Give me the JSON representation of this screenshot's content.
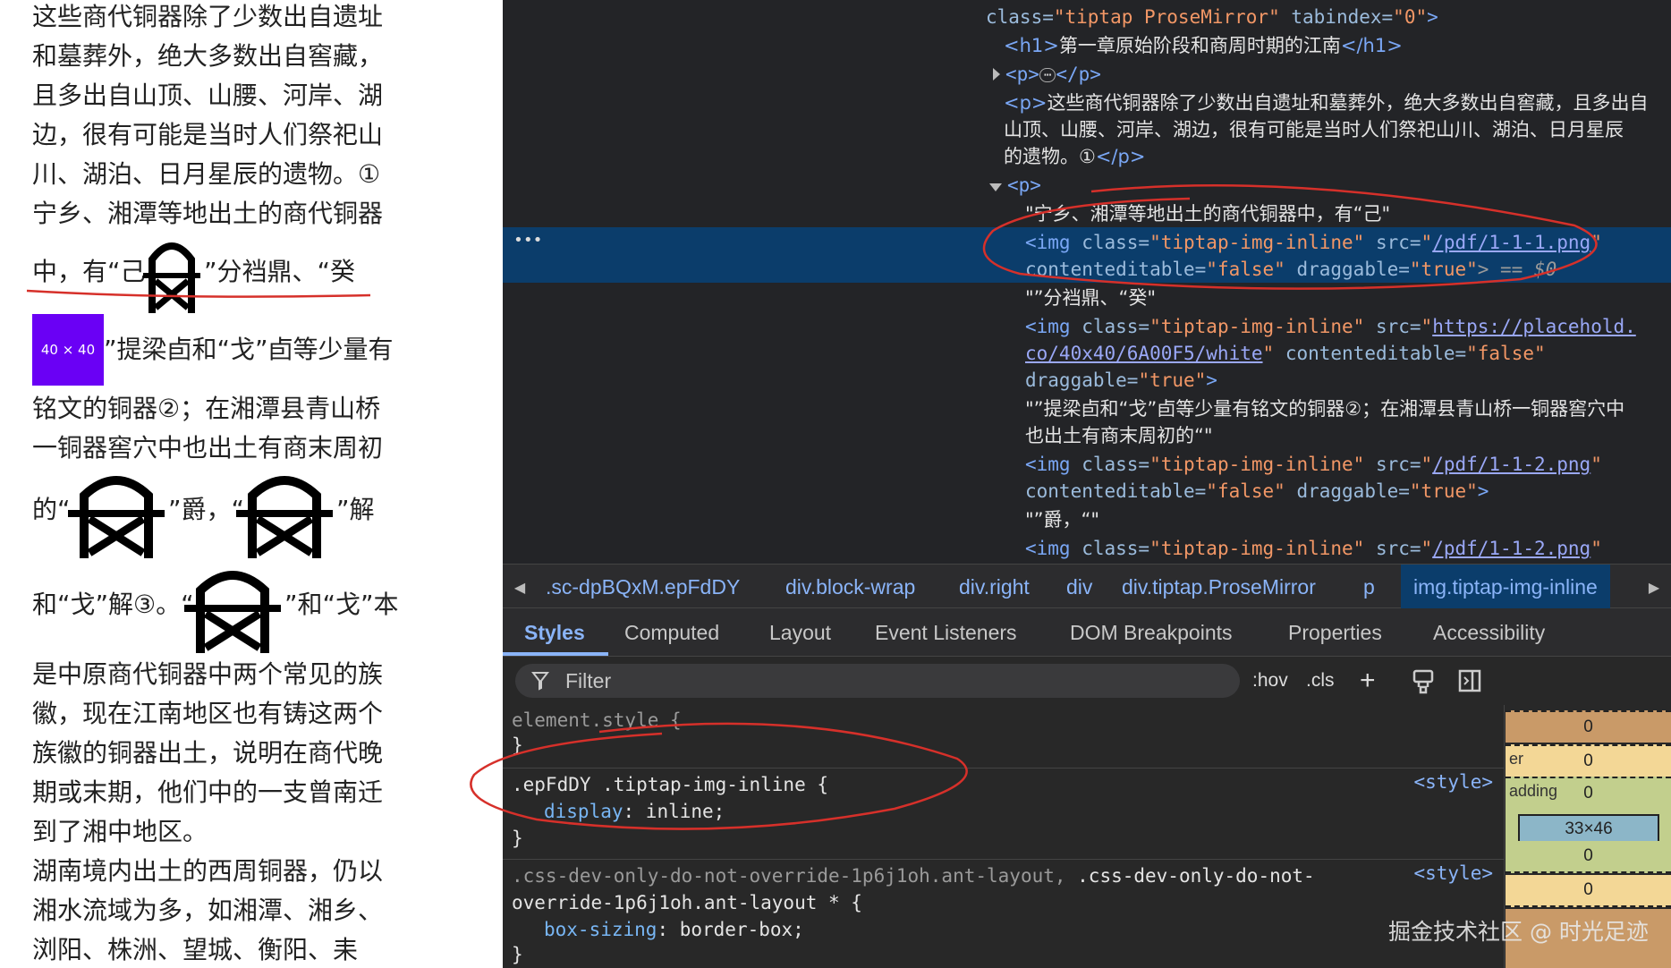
{
  "document": {
    "lines": [
      "这些商代铜器除了少数出自遗址",
      "和墓葬外，绝大多数出自窖藏，",
      "且多出自山顶、山腰、河岸、湖",
      "边，很有可能是当时人们祭祀山",
      "川、湖泊、日月星辰的遗物。①",
      "宁乡、湘潭等地出土的商代铜器"
    ],
    "line7_a": "中，有“己",
    "line7_b": "”分裆鼎、“癸",
    "placeholder_label": "40 × 40",
    "line8_b": "”提梁卣和“戈”卣等少量有",
    "line9": "铭文的铜器②；在湘潭县青山桥",
    "line10": "一铜器窖穴中也出土有商末周初",
    "line11_a": "的“",
    "line11_b": "”爵，“",
    "line11_c": "”解",
    "line12_a": "和“戈”解③。“",
    "line12_b": "”和“戈”本",
    "tail_lines": [
      "是中原商代铜器中两个常见的族",
      "徽，现在江南地区也有铸这两个",
      "族徽的铜器出土，说明在商代晚",
      "期或末期，他们中的一支曾南迁",
      "到了湘中地区。",
      "湖南境内出土的西周铜器，仍以",
      "湘水流域为多，如湘潭、湘乡、",
      "浏阳、株洲、望城、衡阳、耒"
    ]
  },
  "dom": {
    "l1_attr": "class=",
    "l1_val": "\"tiptap ProseMirror\"",
    "l1_attr2": " tabindex=",
    "l1_val2": "\"0\"",
    "l1_close": ">",
    "h1_open": "<h1>",
    "h1_text": "第一章原始阶段和商周时期的江南",
    "h1_close": "</h1>",
    "p_open": "<p>",
    "p_close": "</p>",
    "p_ellipsis": "⋯",
    "p2_text_a": "这些商代铜器除了少数出自遗址和墓葬外，绝大多数出自窖藏，且多出自",
    "p2_text_b": "山顶、山腰、河岸、湖边，很有可能是当时人们祭祀山川、湖泊、日月星辰",
    "p2_text_c": "的遗物。①",
    "p3_text1": "\"宁乡、湘潭等地出土的商代铜器中，有“己\"",
    "img_open": "<img",
    "class_attr": " class=",
    "img_class_val": "\"tiptap-img-inline\"",
    "src_attr": " src=",
    "src1": "/pdf/1-1-1.png",
    "ce_attr": "contenteditable=",
    "ce_val": "\"false\"",
    "drag_attr": " draggable=",
    "drag_val": "\"true\"",
    "sel_marker": "> == $0",
    "text2": "\"”分裆鼎、“癸\"",
    "src2_a": "https://placehold.",
    "src2_b": "co/40x40/6A00F5/white",
    "drag_line": "draggable=",
    "text3_a": "\"”提梁卣和“戈”卣等少量有铭文的铜器②；在湘潭县青山桥一铜器窖穴中",
    "text3_b": "也出土有商末周初的“\"",
    "src3": "/pdf/1-1-2.png",
    "text4": "\"”爵，“\"",
    "quote": "\"",
    "gt": ">"
  },
  "breadcrumb": [
    ".sc-dpBQxM.epFdDY",
    "div.block-wrap",
    "div.right",
    "div",
    "div.tiptap.ProseMirror",
    "p",
    "img.tiptap-img-inline"
  ],
  "tabs": [
    "Styles",
    "Computed",
    "Layout",
    "Event Listeners",
    "DOM Breakpoints",
    "Properties",
    "Accessibility"
  ],
  "filter": {
    "placeholder": "Filter"
  },
  "toolbar": {
    "hov": ":hov",
    "cls": ".cls",
    "add": "+"
  },
  "styles": {
    "element_style": "element.style {",
    "close_brace": "}",
    "rule1_selector": ".epFdDY .tiptap-img-inline {",
    "rule1_prop": "display",
    "rule1_value": ": inline;",
    "source": "<style>",
    "rule2_sel_a_dim": ".css-dev-only-do-not-override-1p6j1oh.ant-layout,",
    "rule2_sel_b": " .css-dev-only-do-not-",
    "rule2_sel_c": "override-1p6j1oh.ant-layout * {",
    "rule2_prop": "box-sizing",
    "rule2_value": ": border-box;"
  },
  "box_model": {
    "margin_top": "0",
    "border_label": "er",
    "border_top": "0",
    "padding_label": "adding",
    "padding_top": "0",
    "content_size": "33×46",
    "padding_bottom": "0",
    "border_bottom": "0"
  },
  "watermark": "掘金技术社区 @ 时光足迹",
  "colors": {
    "annotation": "#d6302a",
    "selection": "#0b3d6b",
    "placeholder_bg": "#6a00f5"
  }
}
